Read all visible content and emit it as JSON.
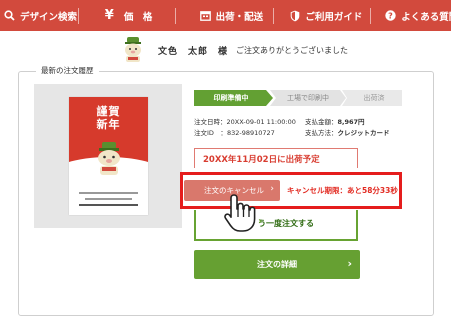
{
  "nav": {
    "items": [
      {
        "label": "デザイン検索",
        "icon": "search-icon"
      },
      {
        "label": "価　格",
        "icon": "yen-icon"
      },
      {
        "label": "出荷・配送",
        "icon": "calendar-icon"
      },
      {
        "label": "ご利用ガイド",
        "icon": "shield-icon"
      },
      {
        "label": "よくある質問",
        "icon": "question-icon"
      }
    ]
  },
  "user": {
    "name": "文色　太郎　様",
    "thanks": "ご注文ありがとうございました"
  },
  "history": {
    "title": "最新の注文履歴",
    "card": {
      "text_line1": "謹賀",
      "text_line2": "新年"
    },
    "steps": [
      {
        "label": "印刷準備中",
        "state": "active"
      },
      {
        "label": "工場で印刷中",
        "state": "inactive"
      },
      {
        "label": "出荷済",
        "state": "inactive"
      }
    ],
    "order": {
      "date_label": "注文日時：",
      "date_value": "20XX-09-01 11:00:00",
      "id_label": "注文ID　：",
      "id_value": "832-98910727",
      "amount_label": "支払金額：",
      "amount_value": "8,967円",
      "method_label": "支払方法：",
      "method_value": "クレジットカード"
    },
    "ship_notice": "20XX年11月02日に出荷予定",
    "cancel_button": "注文のキャンセル",
    "cancel_deadline": "キャンセル期限：あと58分33秒",
    "reorder_button": "う一度注文する",
    "details_button": "注文の詳細"
  },
  "colors": {
    "nav_red": "#d24a3d",
    "accent_green": "#66a032",
    "cancel_red": "#d9786c",
    "highlight_red": "#e51d1d"
  }
}
